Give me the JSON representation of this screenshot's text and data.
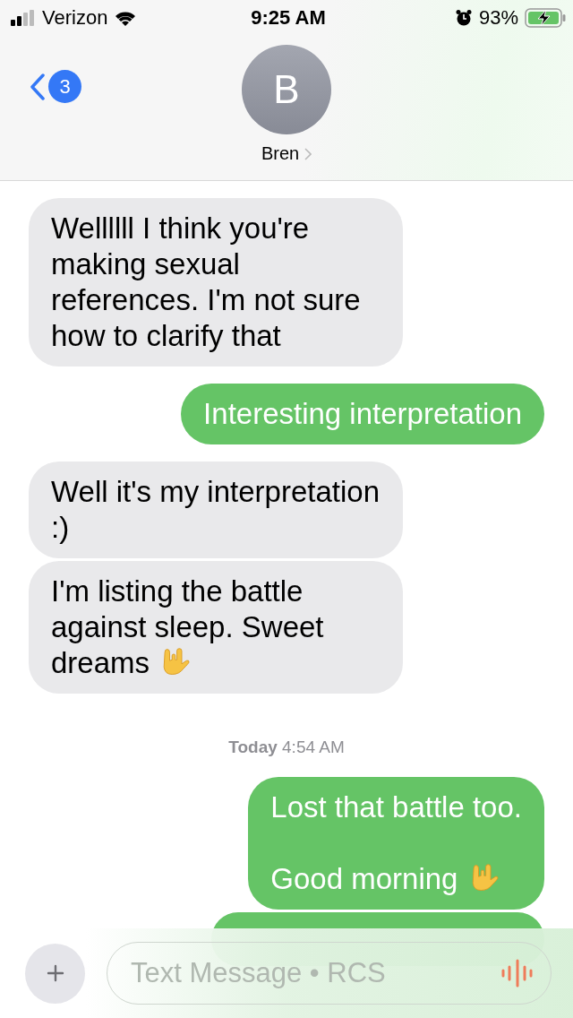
{
  "status_bar": {
    "carrier": "Verizon",
    "time": "9:25 AM",
    "battery": "93%"
  },
  "header": {
    "back_badge": "3",
    "avatar_initial": "B",
    "contact_name": "Bren"
  },
  "messages": [
    {
      "kind": "received",
      "text": "Wellllll I think you're making sexual references. I'm not sure how to clarify that"
    },
    {
      "kind": "sent",
      "text": "Interesting interpretation"
    },
    {
      "kind": "received",
      "text": "Well it's my interpretation :)"
    },
    {
      "kind": "received_gesture",
      "text": "I'm listing the battle against sleep. Sweet dreams"
    },
    {
      "kind": "timestamp",
      "day": "Today",
      "time": "4:54 AM"
    },
    {
      "kind": "sent_gesture",
      "text": "Lost that battle too.\n\nGood morning"
    },
    {
      "kind": "sent_partial"
    }
  ],
  "composer": {
    "placeholder": "Text Message • RCS"
  }
}
